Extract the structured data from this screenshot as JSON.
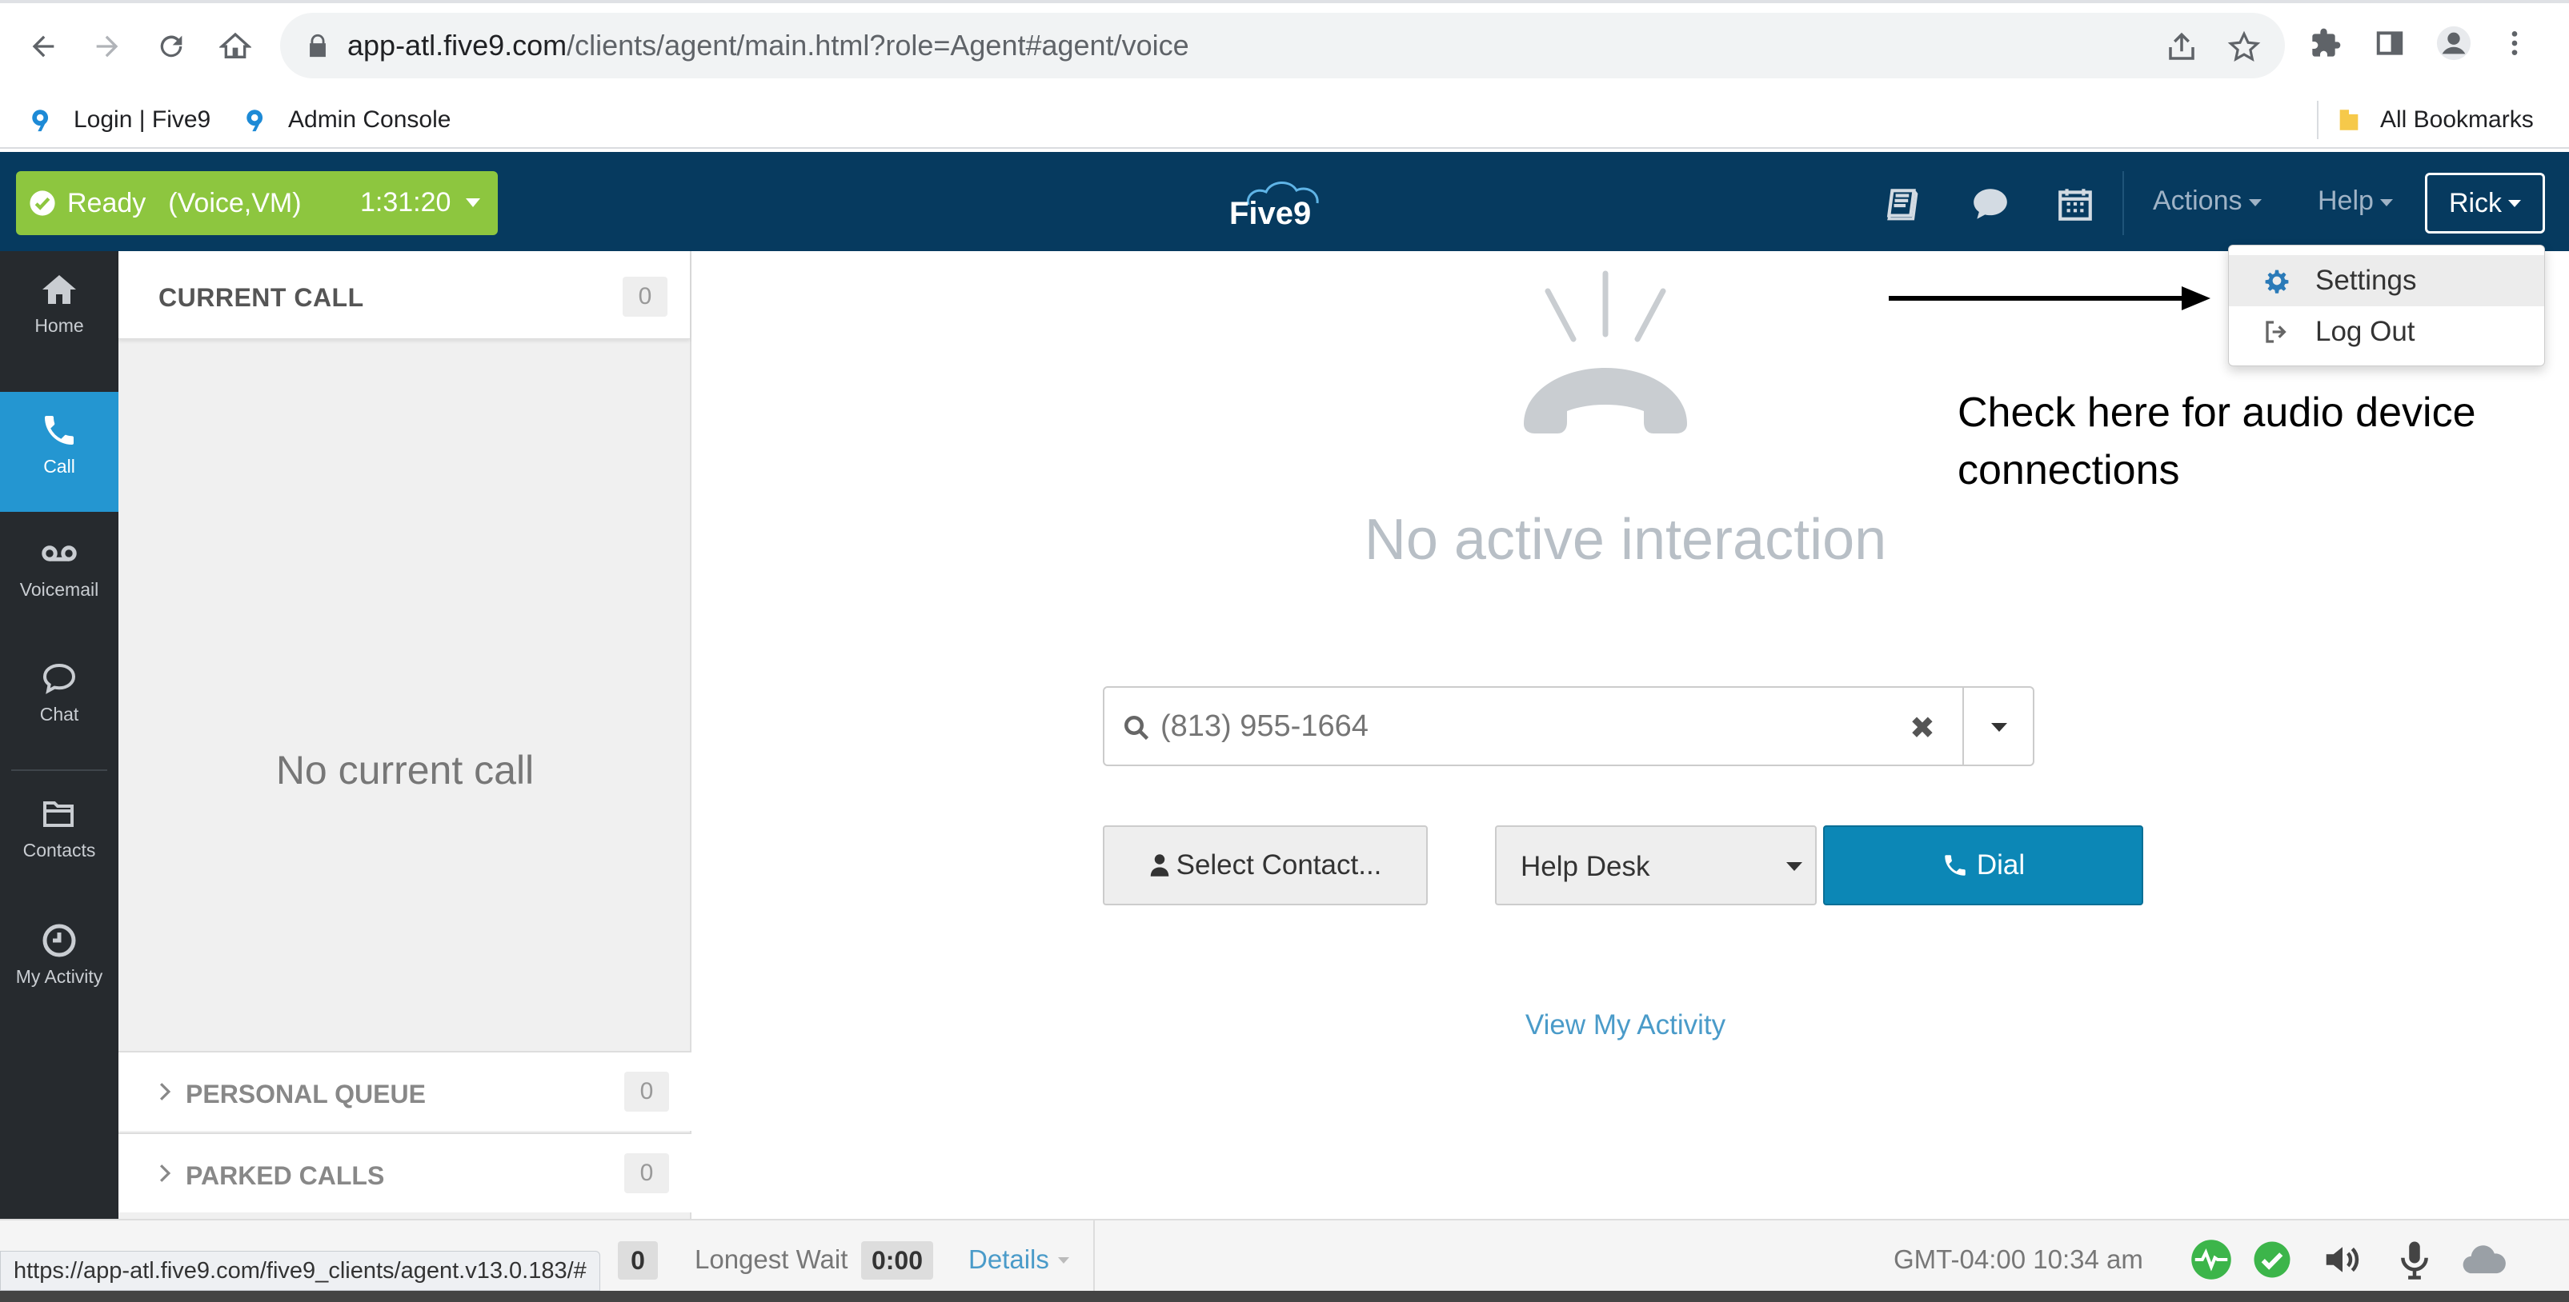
{
  "browser": {
    "url_host": "app-atl.five9.com",
    "url_path": "/clients/agent/main.html?role=Agent#agent/voice",
    "bookmarks": [
      {
        "label": "Login | Five9"
      },
      {
        "label": "Admin Console"
      }
    ],
    "all_bookmarks_label": "All Bookmarks",
    "status_url": "https://app-atl.five9.com/five9_clients/agent.v13.0.183/#"
  },
  "header": {
    "ready_label": "Ready",
    "ready_channels": "(Voice,VM)",
    "ready_timer": "1:31:20",
    "ready_color": "#8dc63f",
    "brand_color": "#063a5f",
    "logo_text": "Five9",
    "actions_label": "Actions",
    "help_label": "Help",
    "user_label": "Rick"
  },
  "user_menu": {
    "items": [
      {
        "label": "Settings",
        "icon": "gear-icon"
      },
      {
        "label": "Log Out",
        "icon": "logout-icon"
      }
    ]
  },
  "left_nav": {
    "items": [
      {
        "label": "Home",
        "icon": "home-icon"
      },
      {
        "label": "Call",
        "icon": "phone-icon",
        "active": true
      },
      {
        "label": "Voicemail",
        "icon": "voicemail-icon"
      },
      {
        "label": "Chat",
        "icon": "chat-icon"
      },
      {
        "label": "Contacts",
        "icon": "folder-icon"
      },
      {
        "label": "My Activity",
        "icon": "clock-icon"
      }
    ]
  },
  "calls_panel": {
    "current_call_title": "CURRENT CALL",
    "current_call_count": "0",
    "no_call_text": "No current call",
    "personal_queue_title": "PERSONAL QUEUE",
    "personal_queue_count": "0",
    "parked_calls_title": "PARKED CALLS",
    "parked_calls_count": "0"
  },
  "main": {
    "no_interaction_text": "No active interaction",
    "dial_placeholder": "(813) 955-1664",
    "select_contact_label": "Select Contact...",
    "campaign_label": "Help Desk",
    "dial_label": "Dial",
    "view_activity_label": "View My Activity"
  },
  "annotation": {
    "line1": "Check here for audio device",
    "line2": "connections"
  },
  "footer": {
    "queue_count": "0",
    "longest_wait_label": "Longest Wait",
    "longest_wait_value": "0:00",
    "details_label": "Details",
    "timezone_time": "GMT-04:00 10:34 am"
  }
}
